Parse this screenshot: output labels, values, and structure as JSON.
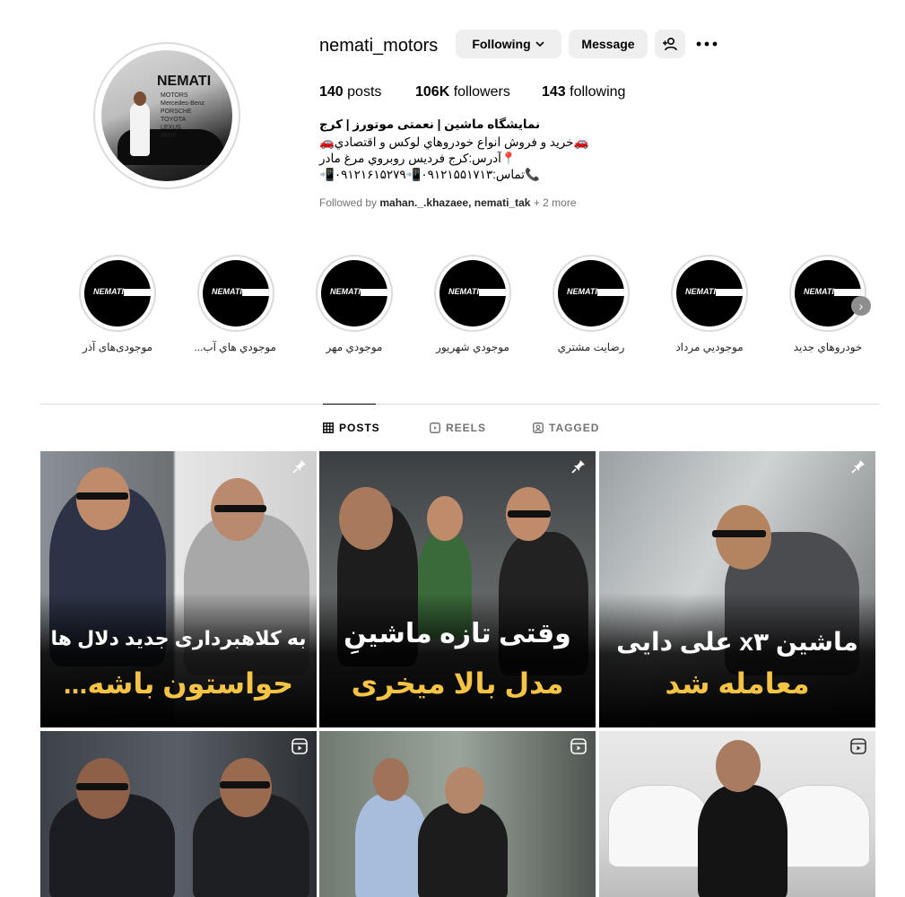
{
  "profile": {
    "username": "nemati_motors",
    "following_button": "Following",
    "message_button": "Message",
    "posts_count": "140",
    "posts_label": "posts",
    "followers_count": "106K",
    "followers_label": "followers",
    "following_count": "143",
    "following_label": "following",
    "avatar_text": "NEMATI",
    "avatar_brands": [
      "MOTORS",
      "Mercedes-Benz",
      "PORSCHE",
      "TOYOTA",
      "LEXUS",
      "BMW"
    ]
  },
  "bio": {
    "name": "نمایشگاه ماشین | نعمتی موتورز | کرج",
    "line1": "🚗خرید و فروش انواع خودروهاي لوکس و اقتصادي🚗",
    "line2": "📍آدرس:کرج فرديس روبروي مرغ مادر",
    "line3": "📞تماس:۰۹۱۲۱۵۵۱۷۱۳📲۰۹۱۲۱۶۱۵۲۷۹📲"
  },
  "followed_by": {
    "prefix": "Followed by",
    "names": "mahan._.khazaee, nemati_tak",
    "more": "+ 2 more"
  },
  "highlights": [
    {
      "label": "موجودی‌های آذر"
    },
    {
      "label": "موجودي هاي آب..."
    },
    {
      "label": "موجودي مهر"
    },
    {
      "label": "موجودي شهريور"
    },
    {
      "label": "رضايت مشتري"
    },
    {
      "label": "موجوديي مرداد"
    },
    {
      "label": "خودروهاي جديد"
    }
  ],
  "highlight_logo": "NEMATI",
  "tabs": {
    "posts": "POSTS",
    "reels": "REELS",
    "tagged": "TAGGED"
  },
  "posts": [
    {
      "line1": "به کلاهبرداری جدید دلال ها",
      "line2": "حواستون باشه...",
      "type": "pinned"
    },
    {
      "line1": "وقتی تازه ماشینِ",
      "line2": "مدل بالا میخری",
      "type": "pinned"
    },
    {
      "line1": "ماشین x۳ علی دایی",
      "line2": "معامله شد",
      "type": "pinned"
    },
    {
      "line1": "",
      "line2": "",
      "type": "reel"
    },
    {
      "line1": "",
      "line2": "",
      "type": "reel"
    },
    {
      "line1": "",
      "line2": "",
      "type": "reel"
    }
  ],
  "colors": {
    "accent_yellow": "#f6c445",
    "button_bg": "#efefef",
    "muted_text": "#737373",
    "divider": "#dbdbdb"
  }
}
